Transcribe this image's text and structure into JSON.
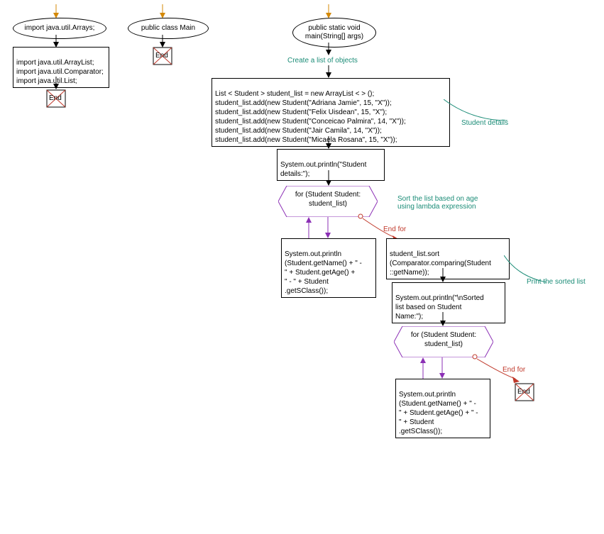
{
  "left": {
    "ellipse1": "import java.util.Arrays;",
    "box1": "import java.util.ArrayList;\nimport java.util.Comparator;\nimport java.util.List;",
    "end1": "End",
    "ellipse2": "public class Main",
    "end2": "End"
  },
  "main": {
    "ellipse_top": "public static void\nmain(String[] args)",
    "annot1": "Create a list of objects",
    "box_code1": "List < Student > student_list = new ArrayList < > ();\nstudent_list.add(new Student(\"Adriana Jamie\", 15, \"X\"));\nstudent_list.add(new Student(\"Felix Uisdean\", 15, \"X\");\nstudent_list.add(new Student(\"Conceicao Palmira\", 14, \"X\"));\nstudent_list.add(new Student(\"Jair Camila\", 14, \"X\"));\nstudent_list.add(new Student(\"Micaela Rosana\", 15, \"X\"));",
    "annot2": "Student details",
    "box_print1": "System.out.println(\"Student\ndetails:\");",
    "hex1": "for (Student Student:\nstudent_list)",
    "annot3": "Sort the list based on age\nusing lambda expression",
    "endfor1": "End for",
    "box_print2": "System.out.println\n(Student.getName() + \" -\n\" + Student.getAge() +\n\" - \" + Student\n.getSClass());",
    "box_sort": "student_list.sort\n(Comparator.comparing(Student\n::getName));",
    "annot4": "Print the sorted list",
    "box_print3": "System.out.println(\"\\nSorted\nlist based on Student\nName:\");",
    "hex2": "for (Student Student:\nstudent_list)",
    "endfor2": "End for",
    "box_print4": "System.out.println\n(Student.getName() + \" -\n\" + Student.getAge() + \" -\n \" + Student\n.getSClass());",
    "end3": "End"
  }
}
